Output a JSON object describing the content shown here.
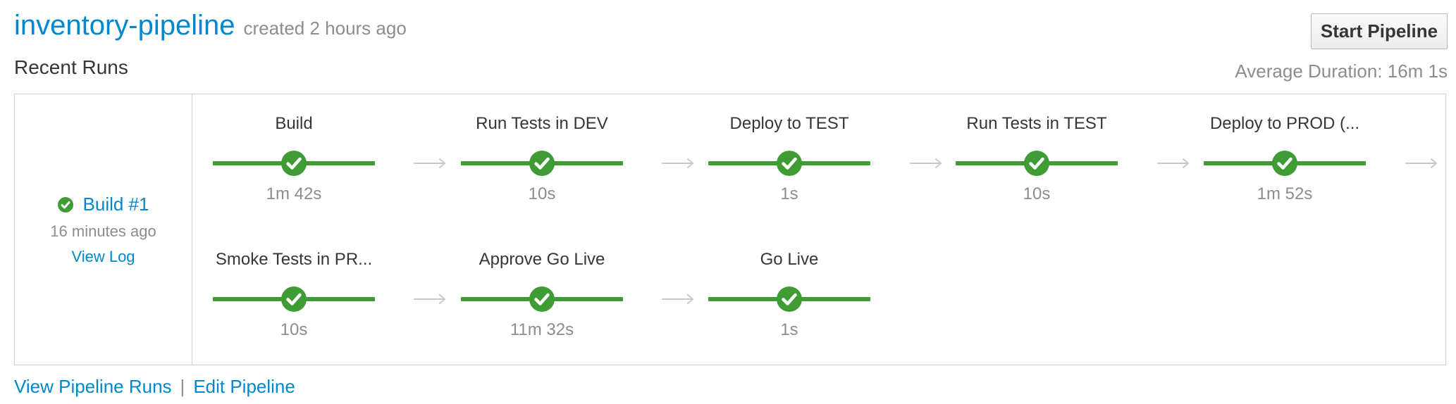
{
  "pipeline": {
    "name": "inventory-pipeline",
    "created": "created 2 hours ago",
    "start_button": "Start Pipeline",
    "recent_runs_label": "Recent Runs",
    "average_duration": "Average Duration: 16m 1s"
  },
  "run": {
    "build_label": "Build #1",
    "time_ago": "16 minutes ago",
    "view_log": "View Log",
    "status": "success"
  },
  "stages": [
    {
      "name": "Build",
      "duration": "1m 42s",
      "status": "success"
    },
    {
      "name": "Run Tests in DEV",
      "duration": "10s",
      "status": "success"
    },
    {
      "name": "Deploy to TEST",
      "duration": "1s",
      "status": "success"
    },
    {
      "name": "Run Tests in TEST",
      "duration": "10s",
      "status": "success"
    },
    {
      "name": "Deploy to PROD (...",
      "duration": "1m 52s",
      "status": "success"
    },
    {
      "name": "Smoke Tests in PR...",
      "duration": "10s",
      "status": "success"
    },
    {
      "name": "Approve Go Live",
      "duration": "11m 32s",
      "status": "success"
    },
    {
      "name": "Go Live",
      "duration": "1s",
      "status": "success"
    }
  ],
  "footer": {
    "view_runs": "View Pipeline Runs",
    "separator": "|",
    "edit": "Edit Pipeline"
  },
  "colors": {
    "success": "#3f9c35",
    "link": "#0088ce",
    "muted": "#8b8d8f",
    "arrow": "#c8c8c8"
  },
  "icons": {
    "stage_status": "check-circle-icon",
    "flow_arrow": "arrow-right-icon"
  }
}
